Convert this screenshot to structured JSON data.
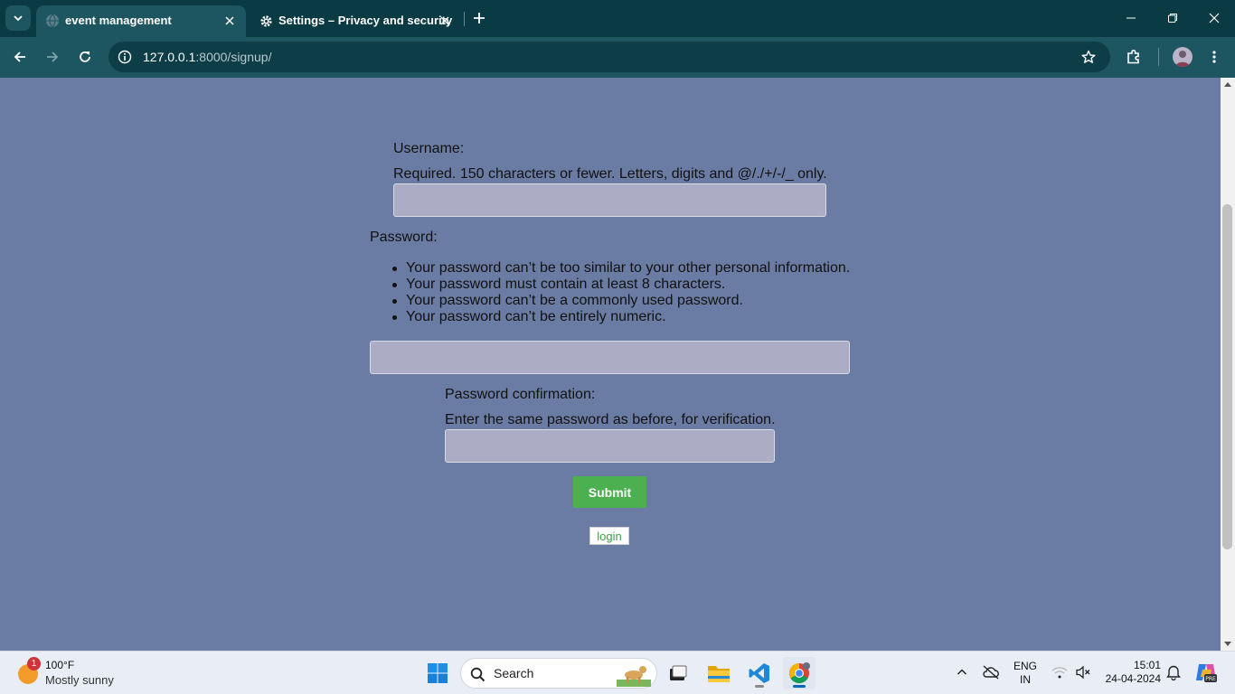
{
  "browser": {
    "tabs": [
      {
        "title": "event management",
        "active": true
      },
      {
        "title": "Settings – Privacy and security",
        "active": false
      }
    ],
    "url": {
      "host": "127.0.0.1",
      "path": ":8000/signup/"
    }
  },
  "form": {
    "username": {
      "label": "Username:",
      "help": "Required. 150 characters or fewer. Letters, digits and @/./+/-/_ only.",
      "value": ""
    },
    "password": {
      "label": "Password:",
      "rules": [
        "Your password can’t be too similar to your other personal information.",
        "Your password must contain at least 8 characters.",
        "Your password can’t be a commonly used password.",
        "Your password can’t be entirely numeric."
      ],
      "value": ""
    },
    "password_confirmation": {
      "label": "Password confirmation:",
      "help": "Enter the same password as before, for verification.",
      "value": ""
    },
    "submit_label": "Submit",
    "login_label": "login"
  },
  "colors": {
    "page_background": "#6a7ca3",
    "submit": "#4caf50",
    "chrome_dark": "#0a3b44",
    "chrome_toolbar": "#1d5560"
  },
  "taskbar": {
    "weather": {
      "badge": "1",
      "temp": "100°F",
      "condition": "Mostly sunny"
    },
    "search_label": "Search",
    "language": {
      "line1": "ENG",
      "line2": "IN"
    },
    "time": "15:01",
    "date": "24-04-2024",
    "apps": [
      "start-icon",
      "search",
      "task-view-icon",
      "file-explorer-icon",
      "vscode-icon",
      "chrome-icon"
    ]
  }
}
